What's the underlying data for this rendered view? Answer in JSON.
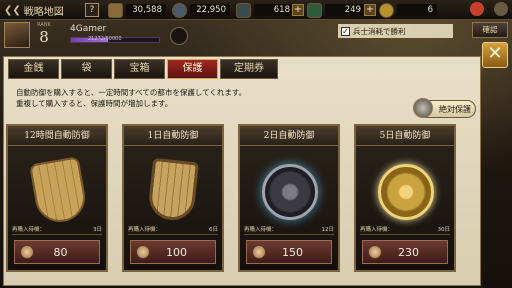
{
  "topbar": {
    "map_title": "戦略地図",
    "help": "?",
    "resources": [
      {
        "icon": "grain-icon",
        "value": "30,588"
      },
      {
        "icon": "gold-icon",
        "value": "22,950"
      },
      {
        "icon": "silver-icon",
        "value": "618"
      },
      {
        "icon": "jade-icon",
        "value": "249"
      },
      {
        "icon": "coin-icon",
        "value": "6"
      }
    ]
  },
  "player": {
    "rank_label": "RANK",
    "rank": "8",
    "name": "4Gamer",
    "xp_text": "21272/50000",
    "xp_fraction": 0.42
  },
  "autowin": {
    "label": "兵士消耗で勝利"
  },
  "confirm_label": "確認",
  "tabs": [
    "金銭",
    "袋",
    "宝箱",
    "保護",
    "定期券"
  ],
  "active_tab": "保護",
  "description": [
    "自動防御を購入すると、一定時間すべての都市を保護してくれます。",
    "重複して購入すると、保護時間が増加します。"
  ],
  "absolute_protection": "絶対保護",
  "cards": [
    {
      "title": "12時間自動防御",
      "limit_label": "再購入待機：",
      "limit_value": "3日",
      "price": "80"
    },
    {
      "title": "1日自動防御",
      "limit_label": "再購入待機：",
      "limit_value": "6日",
      "price": "100"
    },
    {
      "title": "2日自動防御",
      "limit_label": "再購入待機：",
      "limit_value": "12日",
      "price": "150"
    },
    {
      "title": "5日自動防御",
      "limit_label": "再購入待機：",
      "limit_value": "30日",
      "price": "230"
    }
  ],
  "colors": {
    "active_tab": "#a02820",
    "panel": "#e8dfc7",
    "price_bg": "#6c3a30"
  }
}
